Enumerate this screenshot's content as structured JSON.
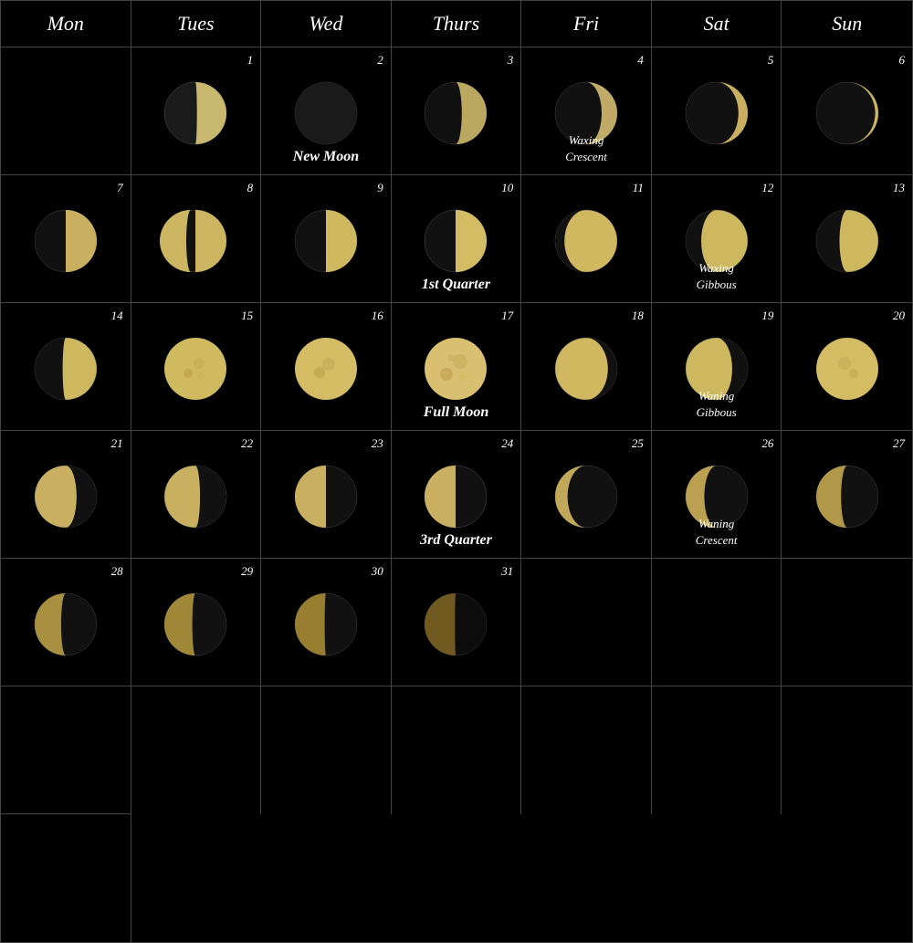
{
  "calendar": {
    "headers": [
      "Mon",
      "Tues",
      "Wed",
      "Thurs",
      "Fri",
      "Sat",
      "Sun"
    ],
    "days": [
      {
        "num": null,
        "phase": null,
        "label": null
      },
      {
        "num": "1",
        "phase": "waxing_crescent_thin",
        "label": null
      },
      {
        "num": "2",
        "phase": "new_moon",
        "label": "New Moon"
      },
      {
        "num": "3",
        "phase": "waxing_crescent_small",
        "label": null
      },
      {
        "num": "4",
        "phase": "waxing_crescent_med",
        "label": "Waxing\nCrescent"
      },
      {
        "num": "5",
        "phase": "waxing_crescent_fat",
        "label": null
      },
      {
        "num": "6",
        "phase": "waxing_crescent_half",
        "label": null
      },
      {
        "num": "7",
        "phase": "first_quarter_almost",
        "label": null
      },
      {
        "num": "8",
        "phase": "first_quarter_near",
        "label": null
      },
      {
        "num": "9",
        "phase": "first_quarter_close",
        "label": null
      },
      {
        "num": "10",
        "phase": "first_quarter",
        "label": "1st Quarter"
      },
      {
        "num": "11",
        "phase": "waxing_gibbous_just",
        "label": null
      },
      {
        "num": "12",
        "phase": "waxing_gibbous",
        "label": "Waxing\nGibbous"
      },
      {
        "num": "13",
        "phase": "waxing_gibbous_fat",
        "label": null
      },
      {
        "num": "14",
        "phase": "full_moon_almost",
        "label": null
      },
      {
        "num": "15",
        "phase": "full_moon_near",
        "label": null
      },
      {
        "num": "16",
        "phase": "full_moon_close",
        "label": null
      },
      {
        "num": "17",
        "phase": "full_moon",
        "label": "Full Moon"
      },
      {
        "num": "18",
        "phase": "waning_gibbous_just",
        "label": null
      },
      {
        "num": "19",
        "phase": "waning_gibbous",
        "label": "Waning\nGibbous"
      },
      {
        "num": "20",
        "phase": "full_moon_bright",
        "label": null
      },
      {
        "num": "21",
        "phase": "waning_gibbous_med",
        "label": null
      },
      {
        "num": "22",
        "phase": "waning_gibbous_fat",
        "label": null
      },
      {
        "num": "23",
        "phase": "third_quarter_near",
        "label": null
      },
      {
        "num": "24",
        "phase": "third_quarter",
        "label": "3rd Quarter"
      },
      {
        "num": "25",
        "phase": "waning_crescent_just",
        "label": null
      },
      {
        "num": "26",
        "phase": "waning_crescent",
        "label": "Waning\nCrescent"
      },
      {
        "num": "27",
        "phase": "waning_crescent_thin",
        "label": null
      },
      {
        "num": "28",
        "phase": "waning_crescent_thinner",
        "label": null
      },
      {
        "num": "29",
        "phase": "waning_crescent_very_thin",
        "label": null
      },
      {
        "num": "30",
        "phase": "waning_crescent_sliver",
        "label": null
      },
      {
        "num": "31",
        "phase": "waning_crescent_new",
        "label": null
      },
      {
        "num": null,
        "phase": null,
        "label": null
      },
      {
        "num": null,
        "phase": null,
        "label": null
      },
      {
        "num": null,
        "phase": null,
        "label": null
      },
      {
        "num": null,
        "phase": null,
        "label": null
      },
      {
        "num": null,
        "phase": null,
        "label": null
      },
      {
        "num": null,
        "phase": null,
        "label": null
      },
      {
        "num": null,
        "phase": null,
        "label": null
      },
      {
        "num": null,
        "phase": null,
        "label": null
      },
      {
        "num": null,
        "phase": null,
        "label": null
      },
      {
        "num": null,
        "phase": null,
        "label": null
      },
      {
        "num": null,
        "phase": null,
        "label": null
      }
    ]
  }
}
